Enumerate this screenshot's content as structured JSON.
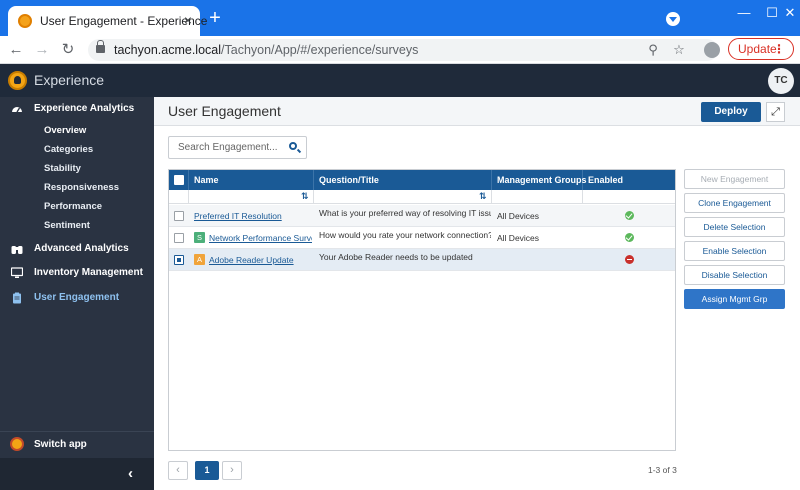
{
  "browser": {
    "tab_title": "User Engagement - Experience",
    "new_tab": "+",
    "url_host": "tachyon.acme.local",
    "url_path": "/Tachyon/App/#/experience/surveys",
    "update_label": "Update"
  },
  "app": {
    "name": "Experience",
    "user_initials": "TC"
  },
  "sidebar": {
    "sections": [
      {
        "label": "Experience Analytics",
        "icon": "dashboard-icon"
      },
      {
        "label": "Advanced Analytics",
        "icon": "binoculars-icon"
      },
      {
        "label": "Inventory Management",
        "icon": "monitor-icon"
      },
      {
        "label": "User Engagement",
        "icon": "clipboard-icon",
        "active": true
      }
    ],
    "analytics_items": [
      "Overview",
      "Categories",
      "Stability",
      "Responsiveness",
      "Performance",
      "Sentiment"
    ],
    "switch_app": "Switch app"
  },
  "page": {
    "title": "User Engagement",
    "deploy_label": "Deploy"
  },
  "search": {
    "placeholder": "Search Engagement..."
  },
  "table": {
    "columns": [
      "Name",
      "Question/Title",
      "Management Groups",
      "Enabled"
    ],
    "rows": [
      {
        "name": "Preferred IT Resolution",
        "badge": "",
        "question": "What is your preferred way of resolving IT issues?",
        "groups": "All Devices",
        "enabled": true,
        "selected": false
      },
      {
        "name": "Network Performance Survey",
        "badge": "S",
        "question": "How would you rate your network connection?",
        "groups": "All Devices",
        "enabled": true,
        "selected": false
      },
      {
        "name": "Adobe Reader Update",
        "badge": "A",
        "question": "Your Adobe Reader needs to be updated",
        "groups": "",
        "enabled": false,
        "selected": true
      }
    ]
  },
  "actions": {
    "new": "New Engagement",
    "clone": "Clone Engagement",
    "delete": "Delete Selection",
    "enable": "Enable Selection",
    "disable": "Disable Selection",
    "assign": "Assign Mgmt Grp"
  },
  "pager": {
    "current_page": "1",
    "count": "1-3 of 3"
  },
  "colors": {
    "accent": "#1a5a96",
    "sidebar_bg": "#2a3342",
    "header_bg": "#1f2a3a",
    "browser_blue": "#1a73e8",
    "enabled_green": "#5cb85c",
    "disabled_red": "#c9302c",
    "badge_green": "#4caf7a",
    "badge_orange": "#f0a43a"
  }
}
